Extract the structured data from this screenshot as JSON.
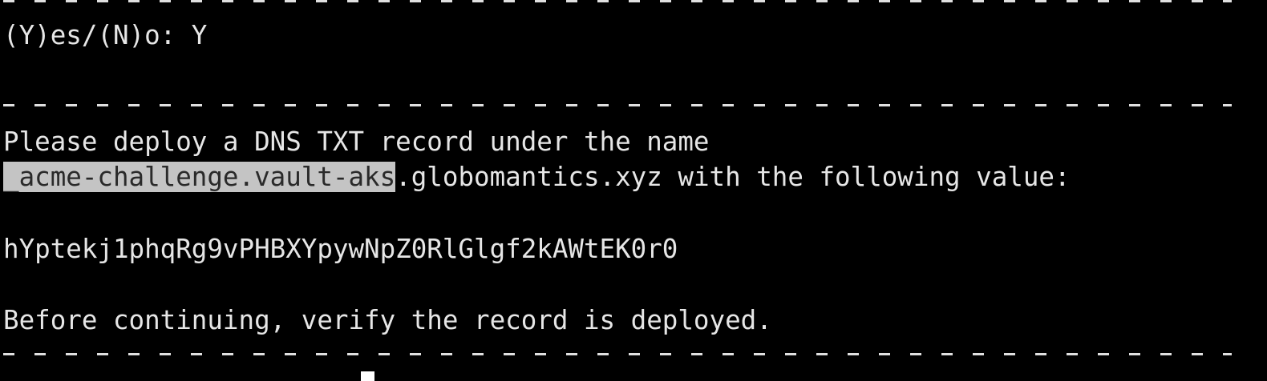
{
  "terminal": {
    "prompt_line": "(Y)es/(N)o: Y",
    "instruction_line": "Please deploy a DNS TXT record under the name",
    "record_name_selected": "_acme-challenge.vault-aks",
    "record_name_rest": ".globomantics.xyz with the following value:",
    "txt_value": "hYptekj1phqRg9vPHBXYpywNpZ0RlGlgf2kAWtEK0r0",
    "verify_line": "Before continuing, verify the record is deployed.",
    "colors": {
      "background": "#000000",
      "foreground": "#e6e6e6",
      "selection": "#c4c4c4"
    }
  }
}
